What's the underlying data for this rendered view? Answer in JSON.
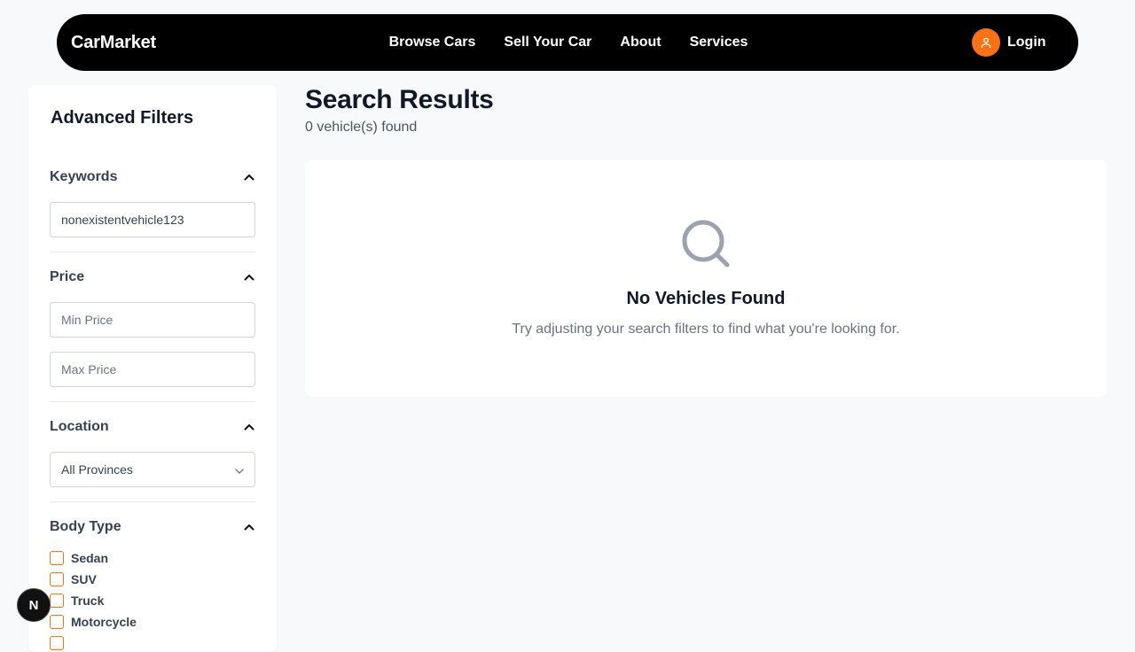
{
  "nav": {
    "brand": "CarMarket",
    "links": [
      "Browse Cars",
      "Sell Your Car",
      "About",
      "Services"
    ],
    "login_label": "Login",
    "accent": "#f97316"
  },
  "filters": {
    "title": "Advanced Filters",
    "keywords": {
      "label": "Keywords",
      "value": "nonexistentvehicle123"
    },
    "price": {
      "label": "Price",
      "min_placeholder": "Min Price",
      "max_placeholder": "Max Price"
    },
    "location": {
      "label": "Location",
      "selected": "All Provinces"
    },
    "body_type": {
      "label": "Body Type",
      "options": [
        "Sedan",
        "SUV",
        "Truck",
        "Motorcycle"
      ]
    }
  },
  "results": {
    "title": "Search Results",
    "count_text": "0 vehicle(s) found",
    "empty_title": "No Vehicles Found",
    "empty_text": "Try adjusting your search filters to find what you're looking for."
  },
  "dev_badge": "N"
}
